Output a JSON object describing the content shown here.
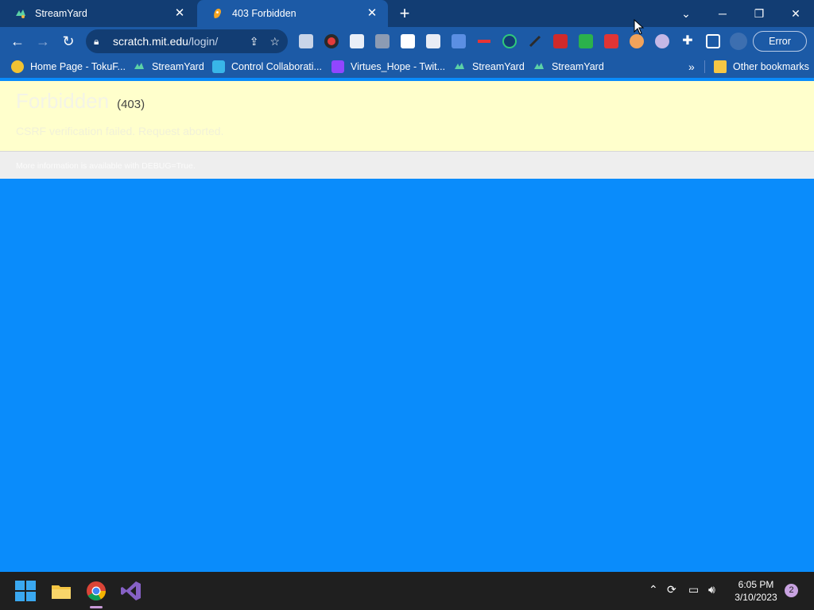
{
  "browser": {
    "tabs": [
      {
        "title": "StreamYard",
        "favicon": "streamyard-icon",
        "active": false
      },
      {
        "title": "403 Forbidden",
        "favicon": "scratch-cat-icon",
        "active": true
      }
    ],
    "new_tab_icon": "plus-icon",
    "window_controls": [
      "chevron-down-icon",
      "minimize-icon",
      "restore-icon",
      "close-icon"
    ],
    "toolbar": {
      "back_icon": "back-arrow-icon",
      "forward_icon": "forward-arrow-icon",
      "reload_icon": "reload-icon",
      "url_host": "scratch.mit.edu",
      "url_path": "/login/",
      "share_icon": "share-icon",
      "star_icon": "star-icon",
      "error_label": "Error"
    },
    "bookmarks": [
      {
        "label": "Home Page - TokuF...",
        "icon": "tokusatsu-icon"
      },
      {
        "label": "StreamYard",
        "icon": "streamyard-icon"
      },
      {
        "label": "Control Collaborati...",
        "icon": "monitor-icon"
      },
      {
        "label": "Virtues_Hope - Twit...",
        "icon": "twitch-icon"
      },
      {
        "label": "StreamYard",
        "icon": "streamyard-icon"
      },
      {
        "label": "StreamYard",
        "icon": "streamyard-icon"
      }
    ],
    "bookmarks_overflow_icon": "double-chevron-icon",
    "other_bookmarks": "Other bookmarks"
  },
  "page": {
    "heading": "Forbidden",
    "status_code": "(403)",
    "reason": "CSRF verification failed. Request aborted.",
    "info": "More information is available with DEBUG=True."
  },
  "taskbar": {
    "time": "6:05 PM",
    "date": "3/10/2023",
    "notification_count": "2"
  },
  "colors": {
    "page_bg": "#0a8cfb",
    "chrome_frame": "#123d73",
    "chrome_toolbar": "#1c5aa6",
    "error_box": "#ffffcc",
    "taskbar": "#1f1f1f"
  }
}
